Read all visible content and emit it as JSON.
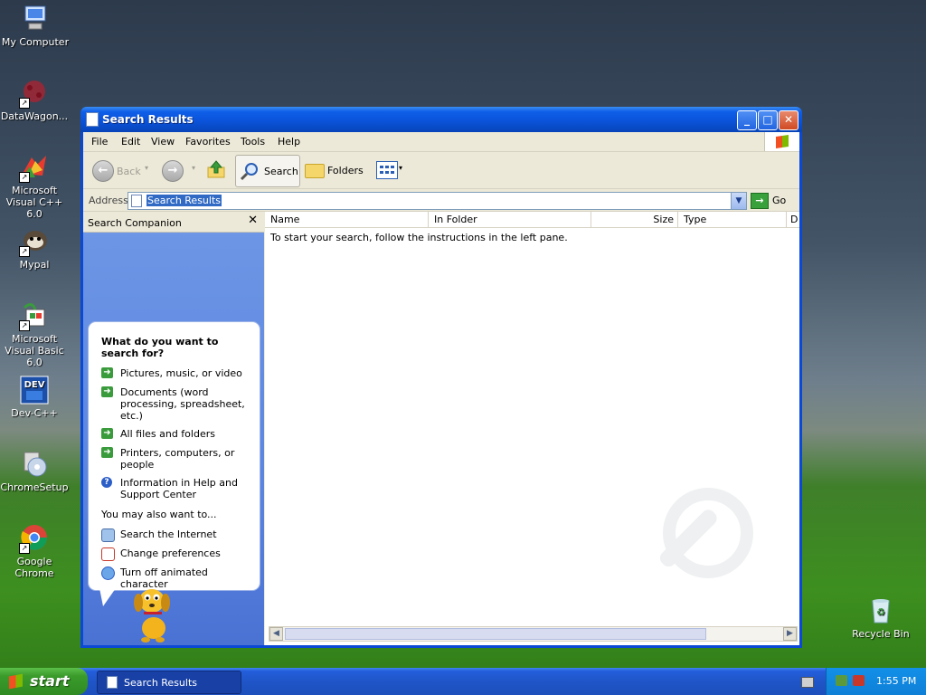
{
  "desktop": {
    "icons": [
      {
        "label": "My Computer"
      },
      {
        "label": "DataWagon..."
      },
      {
        "label": "Microsoft Visual C++ 6.0"
      },
      {
        "label": "Mypal"
      },
      {
        "label": "Microsoft Visual Basic 6.0"
      },
      {
        "label": "Dev-C++"
      },
      {
        "label": "ChromeSetup"
      },
      {
        "label": "Google Chrome"
      },
      {
        "label": "Recycle Bin"
      }
    ]
  },
  "window": {
    "title": "Search Results",
    "menu": [
      "File",
      "Edit",
      "View",
      "Favorites",
      "Tools",
      "Help"
    ],
    "toolbar": {
      "back": "Back",
      "search": "Search",
      "folders": "Folders"
    },
    "address": {
      "label": "Address",
      "value": "Search Results",
      "go": "Go"
    },
    "left_pane": {
      "header": "Search Companion",
      "close": "✕",
      "question": "What do you want to search for?",
      "options": [
        "Pictures, music, or video",
        "Documents (word processing, spreadsheet, etc.)",
        "All files and folders",
        "Printers, computers, or people",
        "Information in Help and Support Center"
      ],
      "also_header": "You may also want to...",
      "also": [
        "Search the Internet",
        "Change preferences",
        "Turn off animated character"
      ]
    },
    "columns": [
      "Name",
      "In Folder",
      "Size",
      "Type",
      "D"
    ],
    "empty_message": "To start your search, follow the instructions in the left pane."
  },
  "taskbar": {
    "start": "start",
    "task_label": "Search Results",
    "clock": "1:55 PM"
  },
  "colors": {
    "xp_blue": "#0a52d8",
    "start_green": "#3a9b2b",
    "pane_blue": "#6f97e6"
  }
}
